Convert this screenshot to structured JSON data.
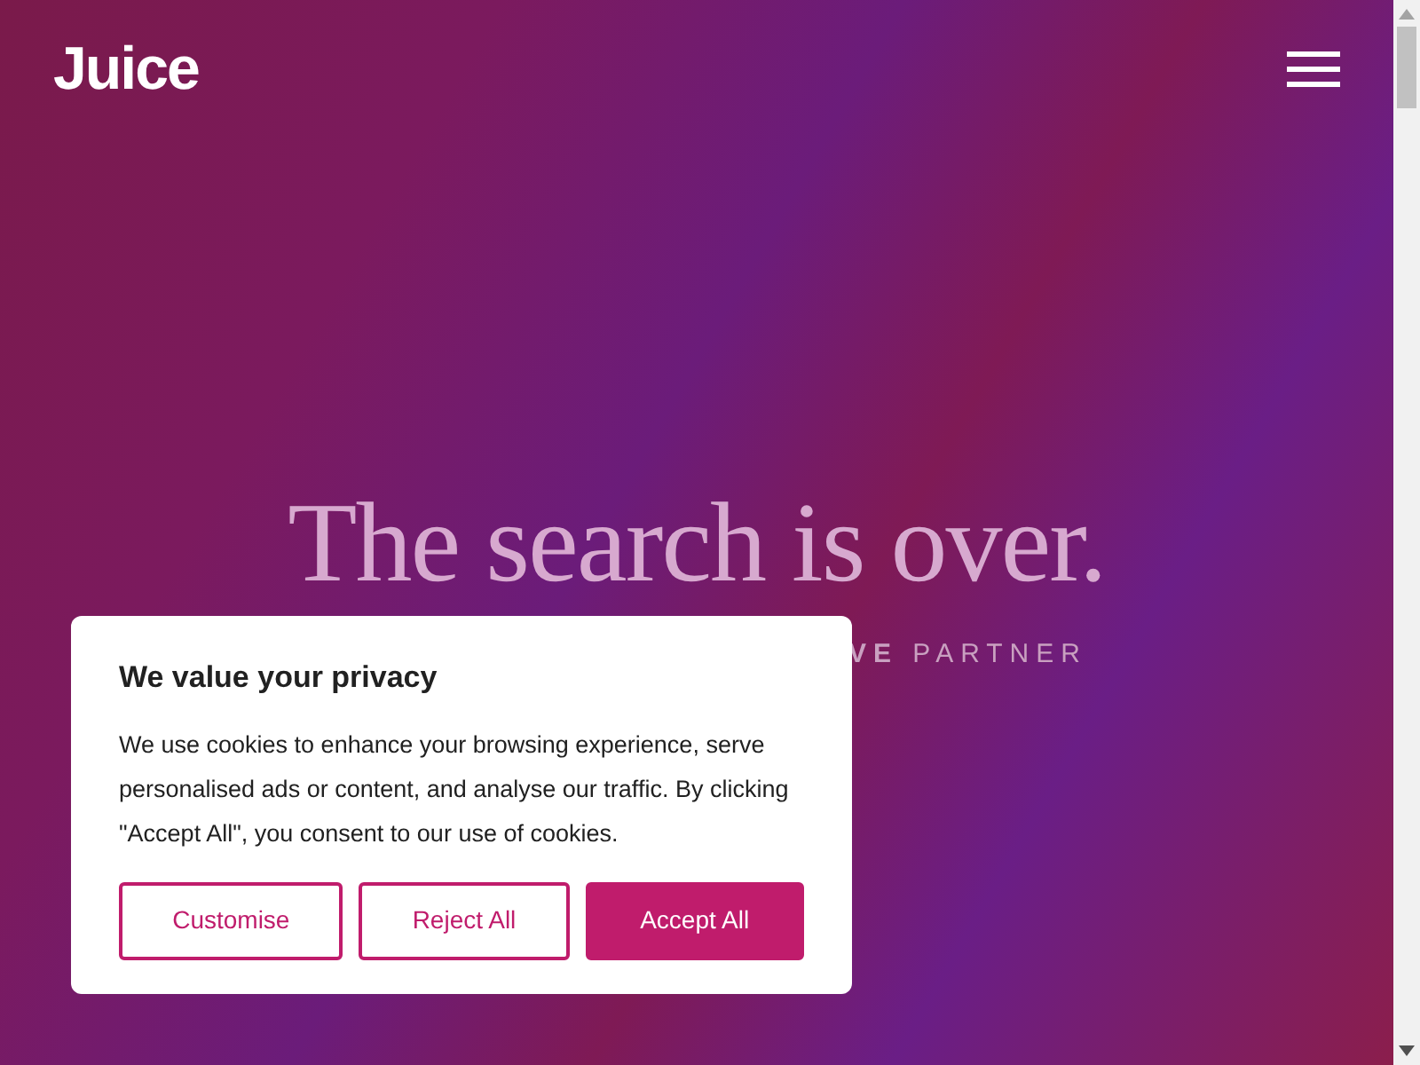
{
  "header": {
    "logo": "Juice"
  },
  "hero": {
    "headline": "The search is over.",
    "subtitle": "**VE** PARTNER"
  },
  "cookie_dialog": {
    "title": "We value your privacy",
    "body": "We use cookies to enhance your browsing experience, serve personalised ads or content, and analyse our traffic. By clicking \"Accept All\", you consent to our use of cookies.",
    "buttons": [
      {
        "label": "Customise",
        "kind": "outline"
      },
      {
        "label": "Reject All",
        "kind": "outline"
      },
      {
        "label": "Accept All",
        "kind": "filled"
      }
    ]
  }
}
